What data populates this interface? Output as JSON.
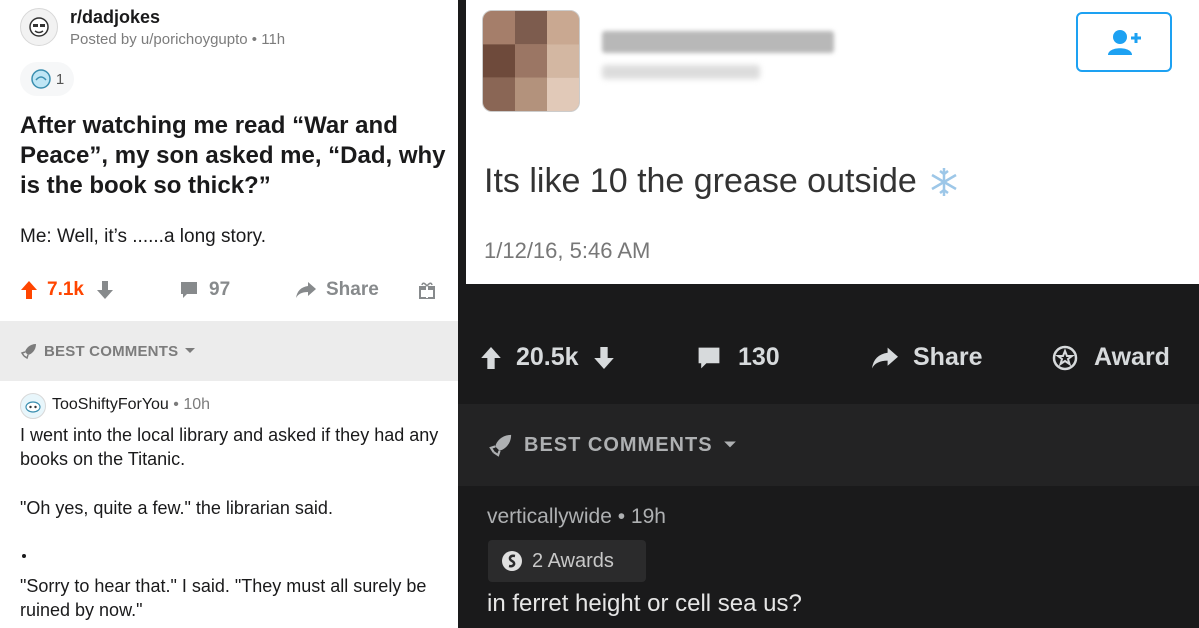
{
  "left_post": {
    "subreddit": "r/dadjokes",
    "posted_by": "Posted by u/porichoygupto",
    "age": "11h",
    "award_count": "1",
    "title": "After watching me read “War and Peace”, my son asked me, “Dad, why is the book so thick?”",
    "body": "Me: Well, it’s ......a long story.",
    "upvotes": "7.1k",
    "comments": "97",
    "share": "Share",
    "best_comments": "BEST COMMENTS",
    "comment": {
      "user": "TooShiftyForYou",
      "age": "10h",
      "line1": "I went into the local library and asked if they had any books on the Titanic.",
      "line2": "\"Oh yes, quite a few.\" the librarian said.",
      "line3": "\"Sorry to hear that.\" I said. \"They must all surely be ruined by now.\""
    }
  },
  "right_post": {
    "tweet_text": "Its like 10 the grease outside",
    "tweet_time": "1/12/16, 5:46 AM",
    "upvotes": "20.5k",
    "comments": "130",
    "share": "Share",
    "award": "Award",
    "best_comments": "BEST COMMENTS",
    "comment": {
      "user": "verticallywide",
      "age": "19h",
      "awards": "2 Awards",
      "text": "in ferret height or cell sea us?"
    }
  },
  "colors": {
    "upvote_orange": "#ff4500",
    "twitter_blue": "#1da1f2",
    "dark_bg": "#1a1a1b"
  }
}
